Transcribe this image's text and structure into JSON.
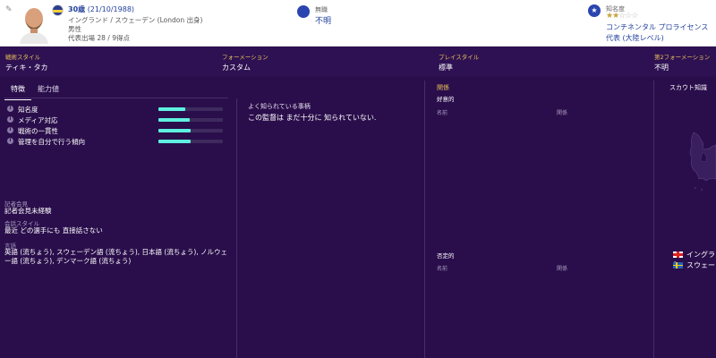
{
  "header": {
    "age": "30歳",
    "dob": "(21/10/1988)",
    "nationality": "イングランド / スウェーデン (London 出身)",
    "gender": "男性",
    "caps": "代表出場 28 / 9得点",
    "club_label": "無職",
    "club_value": "不明",
    "reputation_label": "知名度",
    "reputation_stars": 2,
    "reputation_max": 5,
    "reputation_line1": "コンチネンタル プロライセンス",
    "reputation_line2": "代表 (大陸レベル)"
  },
  "info": {
    "tactical_style_label": "戦術スタイル",
    "tactical_style_value": "ティキ・タカ",
    "formation_label": "フォーメーション",
    "formation_value": "カスタム",
    "playing_style_label": "プレイスタイル",
    "playing_style_value": "標準",
    "second_formation_label": "第2フォーメーション",
    "second_formation_value": "不明"
  },
  "tabs": [
    "特徴",
    "能力値"
  ],
  "attributes": [
    {
      "label": "知名度",
      "value": 0.42
    },
    {
      "label": "メディア対応",
      "value": 0.48
    },
    {
      "label": "戦術の一貫性",
      "value": 0.5
    },
    {
      "label": "管理を自分で行う傾向",
      "value": 0.5
    }
  ],
  "press": {
    "press_label": "記者会見",
    "press_value": "記者会見未経験",
    "talk_label": "会話スタイル",
    "talk_value": "最近 どの選手にも 直接話さない",
    "lang_label": "言語",
    "lang_value": "英語 (流ちょう), スウェーデン語 (流ちょう), 日本語 (流ちょう), ノルウェー語 (流ちょう), デンマーク語 (流ちょう)"
  },
  "known": {
    "title": "よく知られている事柄",
    "text": "この監督は まだ十分に 知られていない."
  },
  "relations": {
    "title": "関係",
    "favored": "好意的",
    "disliked": "否定的",
    "col_name": "名前",
    "col_relation": "関係"
  },
  "scout": {
    "title": "スカウト知識",
    "country1": "イングラン",
    "country2": "スウェー"
  },
  "colors": {
    "accent_gold": "#e8c15a",
    "bar_fill": "#5ef0e0",
    "header_blue": "#1f3f9b"
  }
}
